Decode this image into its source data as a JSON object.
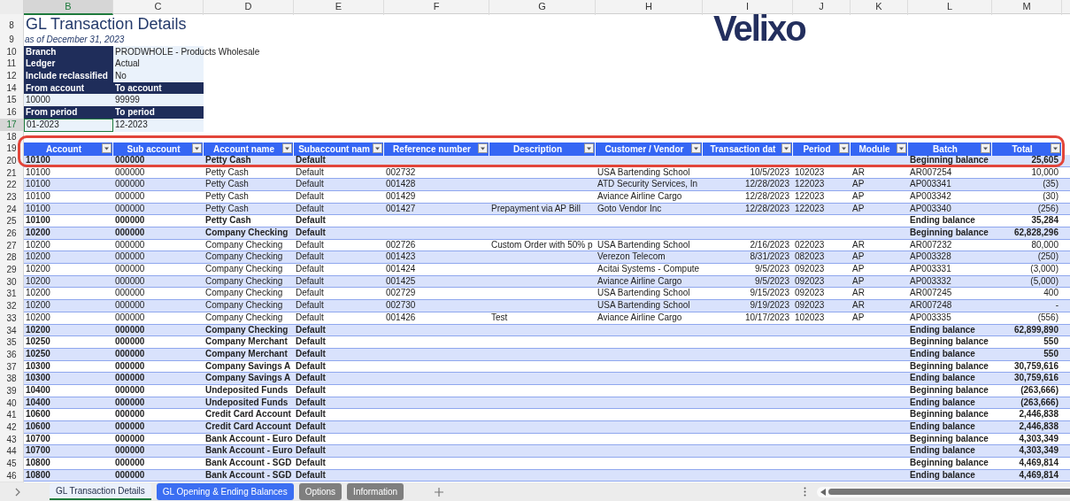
{
  "columns": [
    {
      "letter": "B",
      "selected": true
    },
    {
      "letter": "C",
      "selected": false
    },
    {
      "letter": "D",
      "selected": false
    },
    {
      "letter": "E",
      "selected": false
    },
    {
      "letter": "F",
      "selected": false
    },
    {
      "letter": "G",
      "selected": false
    },
    {
      "letter": "H",
      "selected": false
    },
    {
      "letter": "I",
      "selected": false
    },
    {
      "letter": "J",
      "selected": false
    },
    {
      "letter": "K",
      "selected": false
    },
    {
      "letter": "L",
      "selected": false
    },
    {
      "letter": "M",
      "selected": false
    }
  ],
  "logo": "Velixo",
  "top_rows": [
    {
      "num": "8",
      "kind": "title",
      "text": "GL Transaction Details"
    },
    {
      "num": "9",
      "kind": "subtitle",
      "text": "as of December 31, 2023"
    },
    {
      "num": "10",
      "kind": "param",
      "label": "Branch",
      "value": "PRODWHOLE - Products Wholesale"
    },
    {
      "num": "11",
      "kind": "param",
      "label": "Ledger",
      "value": "Actual"
    },
    {
      "num": "12",
      "kind": "param",
      "label": "Include reclassified",
      "value": "No"
    },
    {
      "num": "14",
      "kind": "heads",
      "cells": [
        "From account",
        "To account"
      ]
    },
    {
      "num": "15",
      "kind": "values",
      "cells": [
        "10000",
        "99999"
      ],
      "selected": false
    },
    {
      "num": "16",
      "kind": "heads",
      "cells": [
        "From period",
        "To period"
      ]
    },
    {
      "num": "17",
      "kind": "values",
      "cells": [
        "01-2023",
        "12-2023"
      ],
      "selected": true
    },
    {
      "num": "18",
      "kind": "blank"
    }
  ],
  "annotation": {
    "kind": "outline"
  },
  "header": {
    "num": "19",
    "columns": [
      "Account",
      "Sub account",
      "Account name",
      "Subaccount nam",
      "Reference number",
      "Description",
      "Customer / Vendor",
      "Transaction dat",
      "Period",
      "Module",
      "Batch",
      "Total"
    ]
  },
  "rows": [
    {
      "num": "20",
      "kind": "summary",
      "account": "10100",
      "sub": "000000",
      "name": "Petty Cash",
      "subaccount": "Default",
      "batch": "Beginning balance",
      "total": "25,605"
    },
    {
      "num": "21",
      "kind": "detail",
      "account": "10100",
      "sub": "000000",
      "name": "Petty Cash",
      "subaccount": "Default",
      "ref": "002732",
      "party": "USA Bartending School",
      "date": "10/5/2023",
      "period": "102023",
      "module": "AR",
      "batch": "AR007254",
      "total": "10,000"
    },
    {
      "num": "22",
      "kind": "detail",
      "account": "10100",
      "sub": "000000",
      "name": "Petty Cash",
      "subaccount": "Default",
      "ref": "001428",
      "party": "ATD Security Services, In",
      "date": "12/28/2023",
      "period": "122023",
      "module": "AP",
      "batch": "AP003341",
      "total": "(35)"
    },
    {
      "num": "23",
      "kind": "detail",
      "account": "10100",
      "sub": "000000",
      "name": "Petty Cash",
      "subaccount": "Default",
      "ref": "001429",
      "party": "Aviance Airline Cargo",
      "date": "12/28/2023",
      "period": "122023",
      "module": "AP",
      "batch": "AP003342",
      "total": "(30)"
    },
    {
      "num": "24",
      "kind": "detail",
      "account": "10100",
      "sub": "000000",
      "name": "Petty Cash",
      "subaccount": "Default",
      "ref": "001427",
      "desc": "Prepayment via AP Bill",
      "party": "Goto Vendor Inc",
      "date": "12/28/2023",
      "period": "122023",
      "module": "AP",
      "batch": "AP003340",
      "total": "(256)"
    },
    {
      "num": "25",
      "kind": "summary",
      "account": "10100",
      "sub": "000000",
      "name": "Petty Cash",
      "subaccount": "Default",
      "batch": "Ending balance",
      "total": "35,284"
    },
    {
      "num": "26",
      "kind": "summary",
      "account": "10200",
      "sub": "000000",
      "name": "Company Checking",
      "subaccount": "Default",
      "batch": "Beginning balance",
      "total": "62,828,296"
    },
    {
      "num": "27",
      "kind": "detail",
      "account": "10200",
      "sub": "000000",
      "name": "Company Checking",
      "subaccount": "Default",
      "ref": "002726",
      "desc": "Custom Order with 50% p",
      "party": "USA Bartending School",
      "date": "2/16/2023",
      "period": "022023",
      "module": "AR",
      "batch": "AR007232",
      "total": "80,000"
    },
    {
      "num": "28",
      "kind": "detail",
      "account": "10200",
      "sub": "000000",
      "name": "Company Checking",
      "subaccount": "Default",
      "ref": "001423",
      "party": "Verezon Telecom",
      "date": "8/31/2023",
      "period": "082023",
      "module": "AP",
      "batch": "AP003328",
      "total": "(250)"
    },
    {
      "num": "29",
      "kind": "detail",
      "account": "10200",
      "sub": "000000",
      "name": "Company Checking",
      "subaccount": "Default",
      "ref": "001424",
      "party": "Acitai Systems - Compute",
      "date": "9/5/2023",
      "period": "092023",
      "module": "AP",
      "batch": "AP003331",
      "total": "(3,000)"
    },
    {
      "num": "30",
      "kind": "detail",
      "account": "10200",
      "sub": "000000",
      "name": "Company Checking",
      "subaccount": "Default",
      "ref": "001425",
      "party": "Aviance Airline Cargo",
      "date": "9/5/2023",
      "period": "092023",
      "module": "AP",
      "batch": "AP003332",
      "total": "(5,000)"
    },
    {
      "num": "31",
      "kind": "detail",
      "account": "10200",
      "sub": "000000",
      "name": "Company Checking",
      "subaccount": "Default",
      "ref": "002729",
      "party": "USA Bartending School",
      "date": "9/15/2023",
      "period": "092023",
      "module": "AR",
      "batch": "AR007245",
      "total": "400"
    },
    {
      "num": "32",
      "kind": "detail",
      "account": "10200",
      "sub": "000000",
      "name": "Company Checking",
      "subaccount": "Default",
      "ref": "002730",
      "party": "USA Bartending School",
      "date": "9/19/2023",
      "period": "092023",
      "module": "AR",
      "batch": "AR007248",
      "total": "-"
    },
    {
      "num": "33",
      "kind": "detail",
      "account": "10200",
      "sub": "000000",
      "name": "Company Checking",
      "subaccount": "Default",
      "ref": "001426",
      "desc": "Test",
      "party": "Aviance Airline Cargo",
      "date": "10/17/2023",
      "period": "102023",
      "module": "AP",
      "batch": "AP003335",
      "total": "(556)"
    },
    {
      "num": "34",
      "kind": "summary",
      "account": "10200",
      "sub": "000000",
      "name": "Company Checking",
      "subaccount": "Default",
      "batch": "Ending balance",
      "total": "62,899,890"
    },
    {
      "num": "35",
      "kind": "summary",
      "account": "10250",
      "sub": "000000",
      "name": "Company Merchant",
      "subaccount": "Default",
      "batch": "Beginning balance",
      "total": "550"
    },
    {
      "num": "36",
      "kind": "summary",
      "account": "10250",
      "sub": "000000",
      "name": "Company Merchant",
      "subaccount": "Default",
      "batch": "Ending balance",
      "total": "550"
    },
    {
      "num": "37",
      "kind": "summary",
      "account": "10300",
      "sub": "000000",
      "name": "Company Savings A",
      "subaccount": "Default",
      "batch": "Beginning balance",
      "total": "30,759,616"
    },
    {
      "num": "38",
      "kind": "summary",
      "account": "10300",
      "sub": "000000",
      "name": "Company Savings A",
      "subaccount": "Default",
      "batch": "Ending balance",
      "total": "30,759,616"
    },
    {
      "num": "39",
      "kind": "summary",
      "account": "10400",
      "sub": "000000",
      "name": "Undeposited Funds",
      "subaccount": "Default",
      "batch": "Beginning balance",
      "total": "(263,666)"
    },
    {
      "num": "40",
      "kind": "summary",
      "account": "10400",
      "sub": "000000",
      "name": "Undeposited Funds",
      "subaccount": "Default",
      "batch": "Ending balance",
      "total": "(263,666)"
    },
    {
      "num": "41",
      "kind": "summary",
      "account": "10600",
      "sub": "000000",
      "name": "Credit Card Account",
      "subaccount": "Default",
      "batch": "Beginning balance",
      "total": "2,446,838"
    },
    {
      "num": "42",
      "kind": "summary",
      "account": "10600",
      "sub": "000000",
      "name": "Credit Card Account",
      "subaccount": "Default",
      "batch": "Ending balance",
      "total": "2,446,838"
    },
    {
      "num": "43",
      "kind": "summary",
      "account": "10700",
      "sub": "000000",
      "name": "Bank Account - Euro",
      "subaccount": "Default",
      "batch": "Beginning balance",
      "total": "4,303,349"
    },
    {
      "num": "44",
      "kind": "summary",
      "account": "10700",
      "sub": "000000",
      "name": "Bank Account - Euro",
      "subaccount": "Default",
      "batch": "Ending balance",
      "total": "4,303,349"
    },
    {
      "num": "45",
      "kind": "summary",
      "account": "10800",
      "sub": "000000",
      "name": "Bank Account - SGD",
      "subaccount": "Default",
      "batch": "Beginning balance",
      "total": "4,469,814"
    },
    {
      "num": "46",
      "kind": "summary",
      "account": "10800",
      "sub": "000000",
      "name": "Bank Account - SGD",
      "subaccount": "Default",
      "batch": "Ending balance",
      "total": "4,469,814"
    }
  ],
  "sheet_tabs": [
    {
      "label": "GL Transaction Details",
      "selected": true,
      "color": "#eaf0fb"
    },
    {
      "label": "GL Opening & Ending Balances",
      "selected": false,
      "color": "#3b6ef2"
    },
    {
      "label": "Options",
      "selected": false,
      "color": "#7f7f7f"
    },
    {
      "label": "Information",
      "selected": false,
      "color": "#7f7f7f"
    }
  ]
}
